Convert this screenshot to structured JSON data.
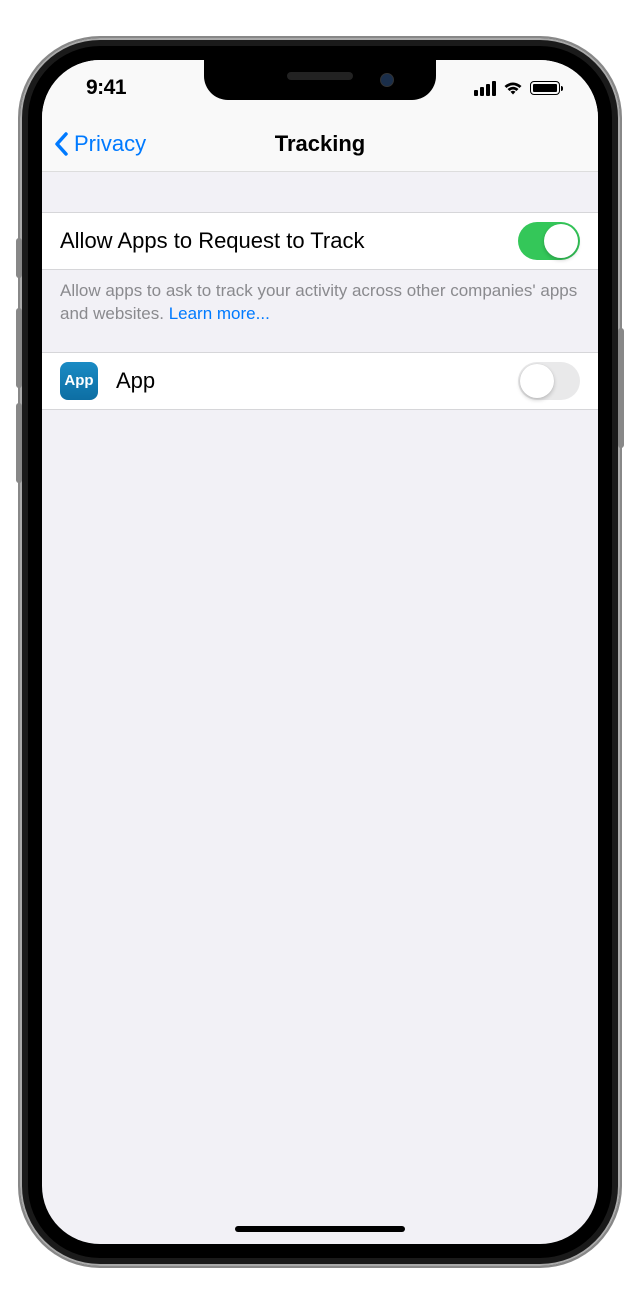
{
  "status": {
    "time": "9:41"
  },
  "nav": {
    "back_label": "Privacy",
    "title": "Tracking"
  },
  "main_toggle": {
    "label": "Allow Apps to Request to Track",
    "on": true
  },
  "footer": {
    "text": "Allow apps to ask to track your activity across other companies' apps and websites. ",
    "link_text": "Learn more..."
  },
  "app_row": {
    "icon_label": "App",
    "name": "App",
    "on": false
  }
}
